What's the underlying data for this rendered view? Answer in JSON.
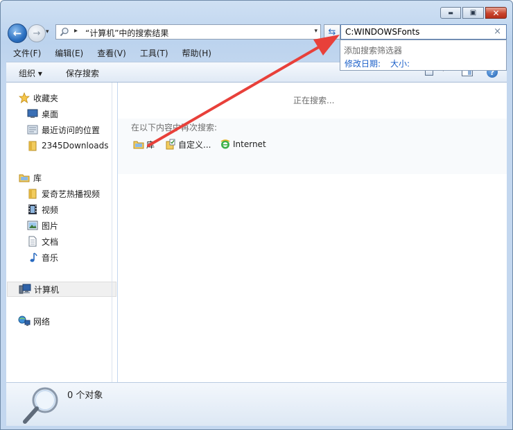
{
  "window": {
    "caption": {
      "minimize": "▬",
      "maximize": "▣",
      "close": "✕"
    }
  },
  "address": {
    "crumb_sep": "▸",
    "location": "“计算机”中的搜索结果",
    "dropdown": "▾"
  },
  "search": {
    "value": "C:WINDOWSFonts",
    "clear": "×",
    "dropdown": {
      "hint": "添加搜索筛选器",
      "filters": [
        "修改日期:",
        "大小:"
      ]
    }
  },
  "menu": [
    "文件(F)",
    "编辑(E)",
    "查看(V)",
    "工具(T)",
    "帮助(H)"
  ],
  "toolbar": {
    "organize": "组织 ▾",
    "save_search": "保存搜索",
    "view_dd": "▾",
    "help": "?"
  },
  "nav": {
    "favorites_header": "收藏夹",
    "favorites": [
      "桌面",
      "最近访问的位置",
      "2345Downloads"
    ],
    "libraries_header": "库",
    "libraries": [
      "爱奇艺热播视频",
      "视频",
      "图片",
      "文档",
      "音乐"
    ],
    "computer": "计算机",
    "network": "网络"
  },
  "content": {
    "status": "正在搜索...",
    "search_again_label": "在以下内容中再次搜索:",
    "search_again_options": [
      "库",
      "自定义...",
      "Internet"
    ]
  },
  "details": {
    "count": "0 个对象"
  },
  "colors": {
    "annotation_arrow": "#e8403a",
    "link_blue": "#1a5fc8"
  }
}
